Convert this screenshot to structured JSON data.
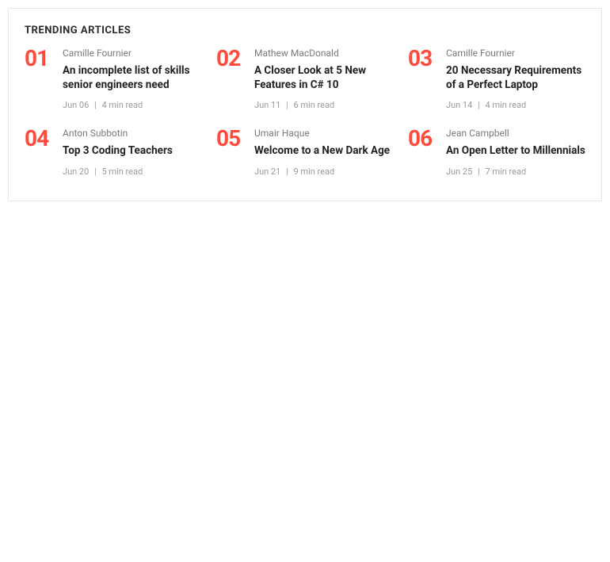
{
  "heading": "TRENDING ARTICLES",
  "articles": [
    {
      "num": "01",
      "author": "Camille Fournier",
      "title": "An incomplete list of skills senior engineers need",
      "date": "Jun 06",
      "read": "4 min read"
    },
    {
      "num": "02",
      "author": "Mathew MacDonald",
      "title": "A Closer Look at 5 New Features in C# 10",
      "date": "Jun 11",
      "read": "6 min read"
    },
    {
      "num": "03",
      "author": "Camille Fournier",
      "title": "20 Necessary Requirements of a Perfect Laptop",
      "date": "Jun 14",
      "read": "4 min read"
    },
    {
      "num": "04",
      "author": "Anton Subbotin",
      "title": "Top 3 Coding Teachers",
      "date": "Jun 20",
      "read": "5 min read"
    },
    {
      "num": "05",
      "author": "Umair Haque",
      "title": "Welcome to a New Dark Age",
      "date": "Jun 21",
      "read": "9 min read"
    },
    {
      "num": "06",
      "author": "Jean Campbell",
      "title": "An Open Letter to Millennials",
      "date": "Jun 25",
      "read": "7 min read"
    }
  ],
  "separator": "|"
}
